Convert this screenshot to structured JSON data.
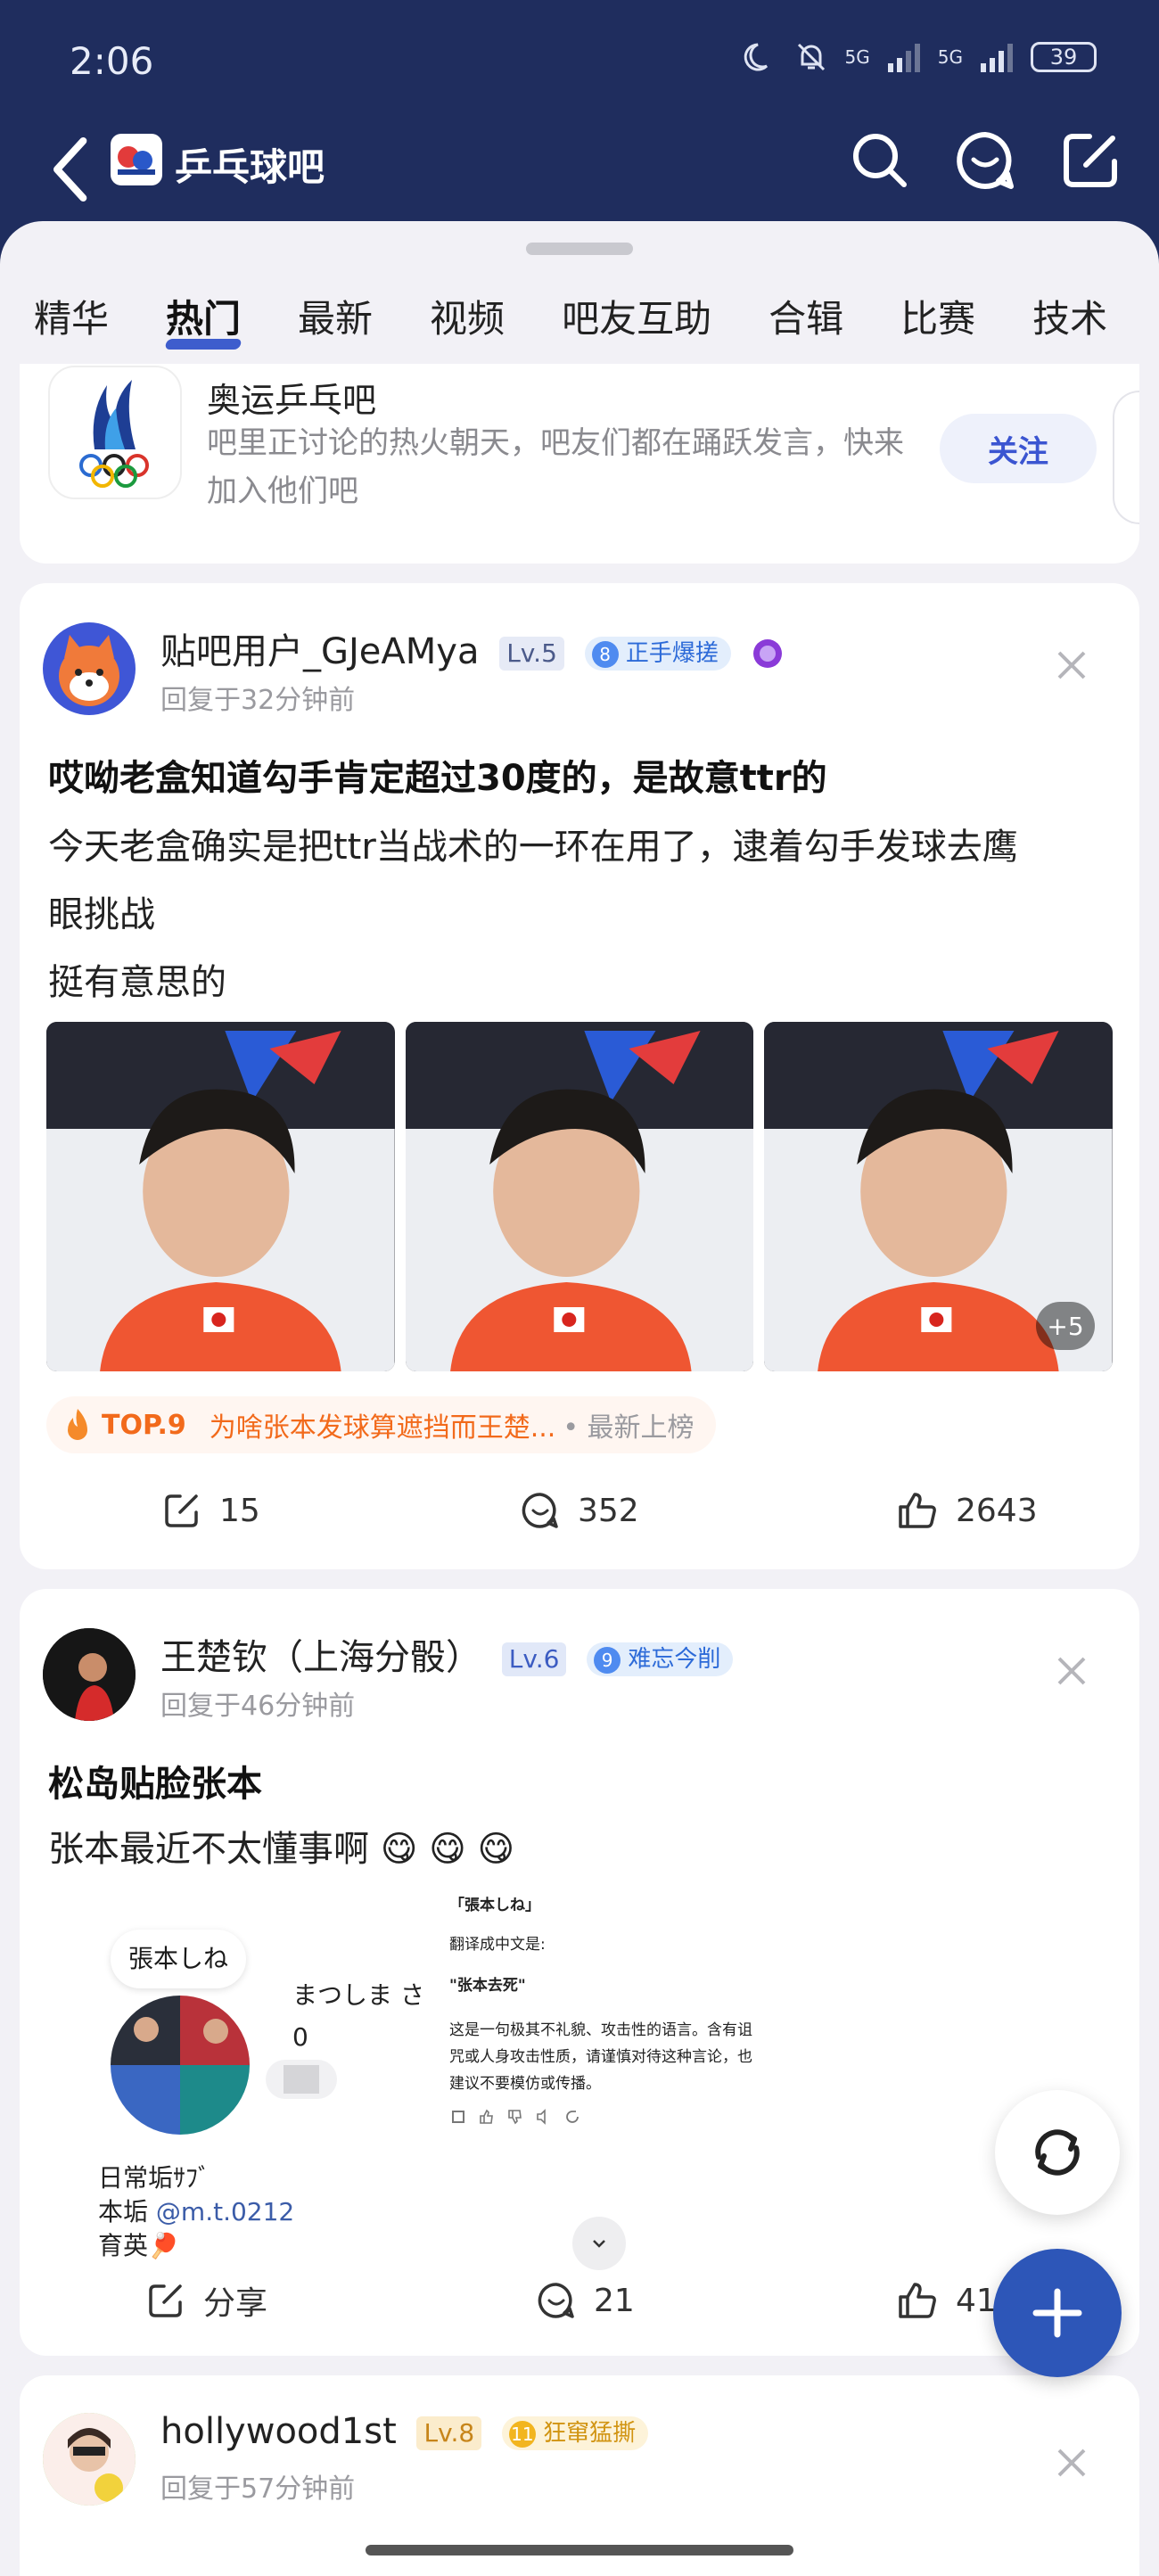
{
  "status": {
    "time": "2:06",
    "battery": "39",
    "signal1": "5G",
    "signal2": "5G"
  },
  "nav": {
    "title": "乒乓球吧"
  },
  "tabs": [
    "精华",
    "热门",
    "最新",
    "视频",
    "吧友互助",
    "合辑",
    "比赛",
    "技术"
  ],
  "active_tab": "热门",
  "forum_card": {
    "name": "奥运乒乓吧",
    "desc": "吧里正讨论的热火朝天，吧友们都在踊跃发言，快来加入他们吧",
    "follow_label": "关注"
  },
  "posts": [
    {
      "username": "贴吧用户_GJeAMya",
      "level": "Lv.5",
      "badge_num": "8",
      "badge_text": "正手爆搓",
      "time": "回复于32分钟前",
      "title": "哎呦老盒知道勾手肯定超过30度的，是故意ttr的",
      "body_lines": [
        "今天老盒确实是把ttr当战术的一环在用了，逮着勾手发球去鹰",
        "眼挑战",
        "挺有意思的"
      ],
      "more_images": "+5",
      "hot_rank": "TOP.9",
      "hot_text": "为啥张本发球算遮挡而王楚...",
      "hot_suffix": "• 最新上榜",
      "share_count": "15",
      "comment_count": "352",
      "like_count": "2643"
    },
    {
      "username": "王楚钦（上海分骰）",
      "level": "Lv.6",
      "badge_num": "9",
      "badge_text": "难忘今削",
      "time": "回复于46分钟前",
      "title": "松岛贴脸张本",
      "body": "张本最近不太懂事啊",
      "emojis": "😋 😋 😋",
      "share_label": "分享",
      "comment_count": "21",
      "like_count": "41",
      "image": {
        "bubble": "張本しね",
        "name_partial": "まつしま さ",
        "follow_count": "0",
        "bio1": "日常垢ｻﾌﾞ",
        "bio2_prefix": "本垢",
        "bio2_handle": "@m.t.0212",
        "bio3": "育英🏓",
        "trans_title": "「張本しね」",
        "trans_label": "翻译成中文是:",
        "trans_result": "\"张本去死\"",
        "trans_note": "这是一句极其不礼貌、攻击性的语言。含有诅咒或人身攻击性质，请谨慎对待这种言论，也建议不要模仿或传播。"
      }
    },
    {
      "username": "hollywood1st",
      "level": "Lv.8",
      "badge_num": "11",
      "badge_text": "狂窜猛撕",
      "time": "回复于57分钟前"
    }
  ]
}
